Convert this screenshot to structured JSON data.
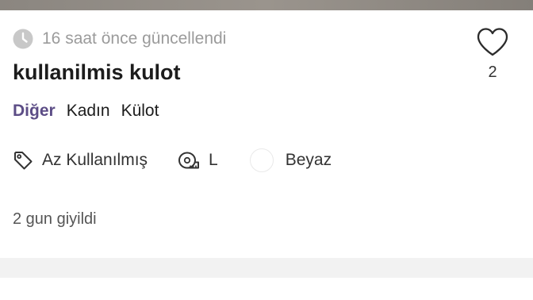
{
  "listing": {
    "updated_text": "16 saat önce güncellendi",
    "title": "kullanilmis kulot",
    "like_count": "2",
    "categories": [
      {
        "label": "Diğer",
        "accent": true
      },
      {
        "label": "Kadın",
        "accent": false
      },
      {
        "label": "Külot",
        "accent": false
      }
    ],
    "attributes": {
      "condition": {
        "icon": "tag-icon",
        "label": "Az Kullanılmış"
      },
      "size": {
        "icon": "measuring-tape-icon",
        "label": "L"
      },
      "color": {
        "icon": "color-swatch",
        "label": "Beyaz",
        "swatch": "#ffffff"
      }
    },
    "description": "2 gun giyildi"
  },
  "colors": {
    "accent": "#5c4d86",
    "muted_text": "#9b9b9b",
    "divider": "#f2f2f2"
  }
}
